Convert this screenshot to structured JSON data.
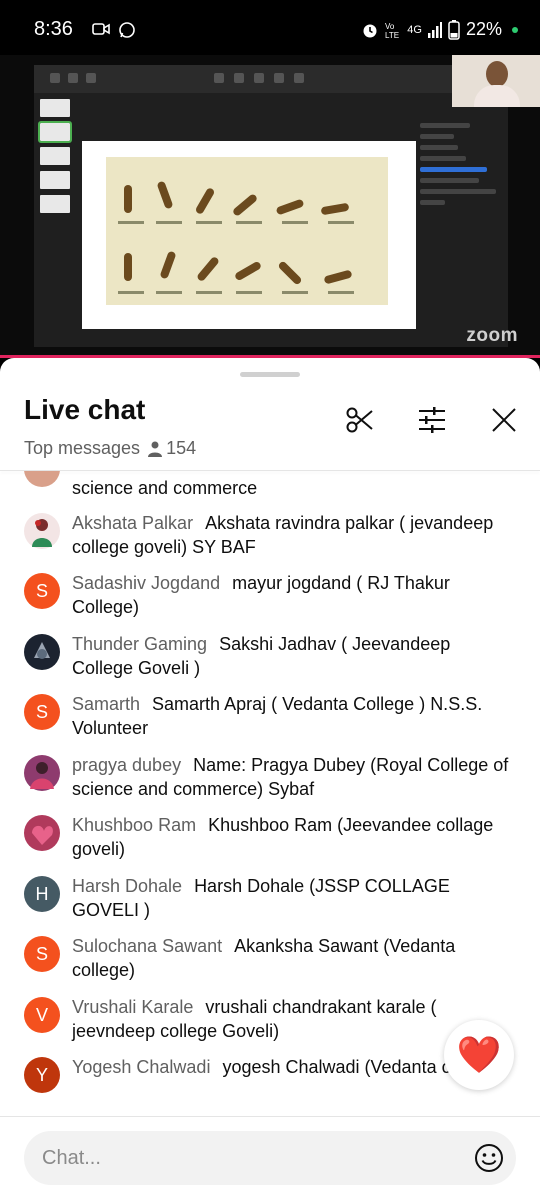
{
  "status_bar": {
    "time": "8:36",
    "network": "4G",
    "battery": "22%"
  },
  "video": {
    "logo": "zoom"
  },
  "chat": {
    "title": "Live chat",
    "mode": "Top messages",
    "viewers": "154",
    "partial_message": "science and commerce",
    "input_placeholder": "Chat...",
    "heart": "❤️",
    "messages": [
      {
        "author": "Akshata Palkar",
        "text": "Akshata ravindra palkar ( jevandeep college goveli) SY BAF",
        "avatar": "photo",
        "color": "#c0392b"
      },
      {
        "author": "Sadashiv Jogdand",
        "text": "mayur jogdand ( RJ Thakur College)",
        "avatar": "S",
        "color": "#f4511e"
      },
      {
        "author": "Thunder Gaming",
        "text": "Sakshi Jadhav ( Jeevandeep College Goveli )",
        "avatar": "photo",
        "color": "#1c2330"
      },
      {
        "author": "Samarth",
        "text": "Samarth Apraj ( Vedanta College ) N.S.S. Volunteer",
        "avatar": "S",
        "color": "#f4511e"
      },
      {
        "author": "pragya dubey",
        "text": "Name: Pragya Dubey (Royal College of science and commerce) Sybaf",
        "avatar": "photo",
        "color": "#8e3b6e"
      },
      {
        "author": "Khushboo Ram",
        "text": "Khushboo Ram (Jeevandee collage goveli)",
        "avatar": "photo",
        "color": "#b03a5c"
      },
      {
        "author": "Harsh Dohale",
        "text": "Harsh Dohale (JSSP COLLAGE GOVELI )",
        "avatar": "H",
        "color": "#455a64"
      },
      {
        "author": "Sulochana Sawant",
        "text": "Akanksha Sawant (Vedanta college)",
        "avatar": "S",
        "color": "#f4511e"
      },
      {
        "author": "Vrushali Karale",
        "text": "vrushali chandrakant karale ( jeevndeep college Goveli)",
        "avatar": "V",
        "color": "#f4511e"
      },
      {
        "author": "Yogesh Chalwadi",
        "text": "yogesh Chalwadi (Vedanta college)",
        "avatar": "Y",
        "color": "#bf360c"
      }
    ]
  }
}
